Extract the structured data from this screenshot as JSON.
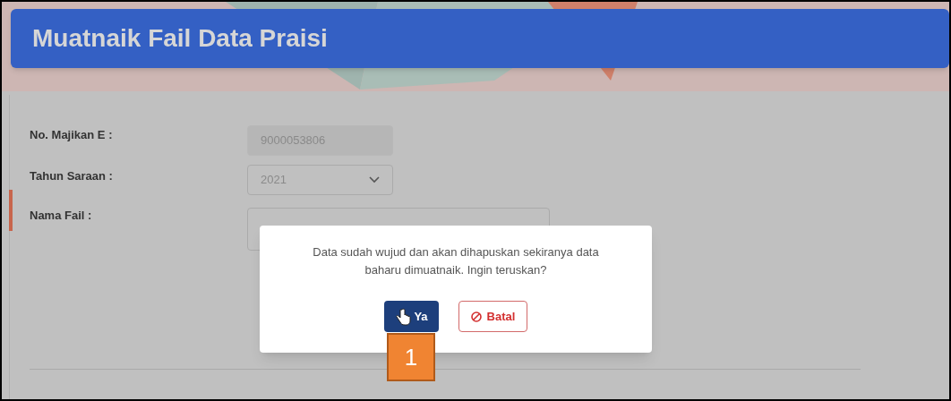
{
  "header": {
    "title": "Muatnaik Fail Data Praisi"
  },
  "form": {
    "fields": [
      {
        "label": "No. Majikan E :",
        "kind": "readonly",
        "value": "9000053806"
      },
      {
        "label": "Tahun Saraan :",
        "kind": "select",
        "value": "2021"
      },
      {
        "label": "Nama Fail :",
        "kind": "file"
      }
    ]
  },
  "dialog": {
    "message": "Data sudah wujud dan akan dihapuskan sekiranya data baharu dimuatnaik. Ingin teruskan?",
    "buttons": [
      {
        "label": "Ya",
        "kind": "confirm"
      },
      {
        "label": "Batal",
        "kind": "cancel"
      }
    ]
  },
  "callout": {
    "label": "1"
  }
}
